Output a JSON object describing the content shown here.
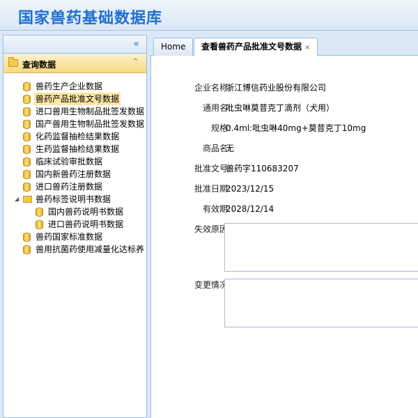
{
  "header": {
    "title": "国家兽药基础数据库"
  },
  "sidebar": {
    "collapse_icon": "«",
    "section_label": "查询数据",
    "section_toggle_icon": "⌃",
    "items": [
      {
        "label": "兽药生产企业数据"
      },
      {
        "label": "兽药产品批准文号数据"
      },
      {
        "label": "进口兽用生物制品批签发数据"
      },
      {
        "label": "国产兽用生物制品批签发数据"
      },
      {
        "label": "化药监督抽检结果数据"
      },
      {
        "label": "生药监督抽检结果数据"
      },
      {
        "label": "临床试验审批数据"
      },
      {
        "label": "国内新兽药注册数据"
      },
      {
        "label": "进口兽药注册数据"
      },
      {
        "label": "兽药标签说明书数据"
      },
      {
        "label": "国内兽药说明书数据"
      },
      {
        "label": "进口兽药说明书数据"
      },
      {
        "label": "兽药国家标准数据"
      },
      {
        "label": "兽用抗菌药使用减量化达标养"
      }
    ]
  },
  "tabs": [
    {
      "label": "Home"
    },
    {
      "label": "查看兽药产品批准文号数据",
      "close": "×"
    }
  ],
  "detail": {
    "company_label": "企业名称:",
    "company_value": "浙江博信药业股份有限公司",
    "generic_label": "通用名:",
    "generic_value": "吡虫啉莫昔克丁滴剂（犬用）",
    "spec_label": "规格:",
    "spec_value": "0.4ml:吡虫啉40mg+莫昔克丁10mg",
    "trade_label": "商品名:",
    "trade_value": "无",
    "approval_label": "批准文号:",
    "approval_value": "兽药字110683207",
    "date_label": "批准日期:",
    "date_value": "2023/12/15",
    "expiry_label": "有效期:",
    "expiry_value": "2028/12/14",
    "invalid_label": "失效原因:",
    "invalid_value": "",
    "change_label": "变更情况:",
    "change_value": ""
  }
}
